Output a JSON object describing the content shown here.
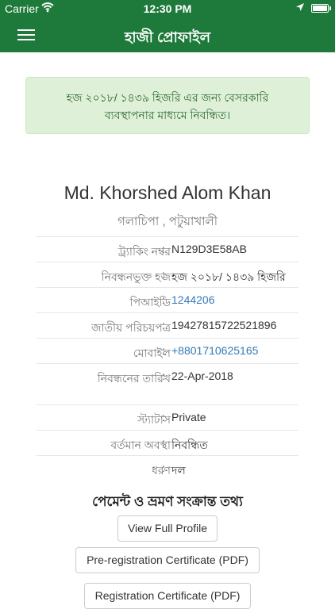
{
  "status_bar": {
    "carrier": "Carrier",
    "time": "12:30 PM"
  },
  "header": {
    "title": "হাজী প্রোফাইল"
  },
  "alert": {
    "text": "হজ ২০১৮/ ১৪৩৯ হিজরি এর জন্য বেসরকারি ব্যবস্থাপনার মাধ্যমে নিবন্ধিত।"
  },
  "profile": {
    "name": "Md. Khorshed Alom Khan",
    "location": "গলাচিপা , পটুয়াখালী",
    "rows": [
      {
        "label": "ট্র্যাকিং নম্বর",
        "value": "N129D3E58AB"
      },
      {
        "label": "নিবন্ধনভুক্ত হজ",
        "value": "হজ ২০১৮/ ১৪৩৯ হিজরি"
      },
      {
        "label": "পিআইডি",
        "value": "1244206"
      },
      {
        "label": "জাতীয় পরিচয়পত্র",
        "value": "19427815722521896"
      },
      {
        "label": "মোবাইল",
        "value": "+8801710625165"
      },
      {
        "label": "নিবন্ধনের তারিখ",
        "value": "22-Apr-2018"
      },
      {
        "label": "স্ট্যাটাস",
        "value": "Private"
      },
      {
        "label": "বর্তমান অবস্থা",
        "value": "নিবন্ধিত"
      },
      {
        "label": "ধরণ",
        "value": "দল"
      }
    ],
    "colon": ":"
  },
  "payment_section": {
    "title": "পেমেন্ট ও ভ্রমণ সংক্রান্ত তথ্য",
    "buttons": {
      "view_full_profile": "View Full Profile",
      "pre_registration_certificate": "Pre-registration Certificate (PDF)",
      "registration_certificate": "Registration Certificate (PDF)"
    }
  },
  "colors": {
    "brand_green": "#1e7a3a",
    "alert_bg": "#dff0d8",
    "link": "#337ab7"
  }
}
